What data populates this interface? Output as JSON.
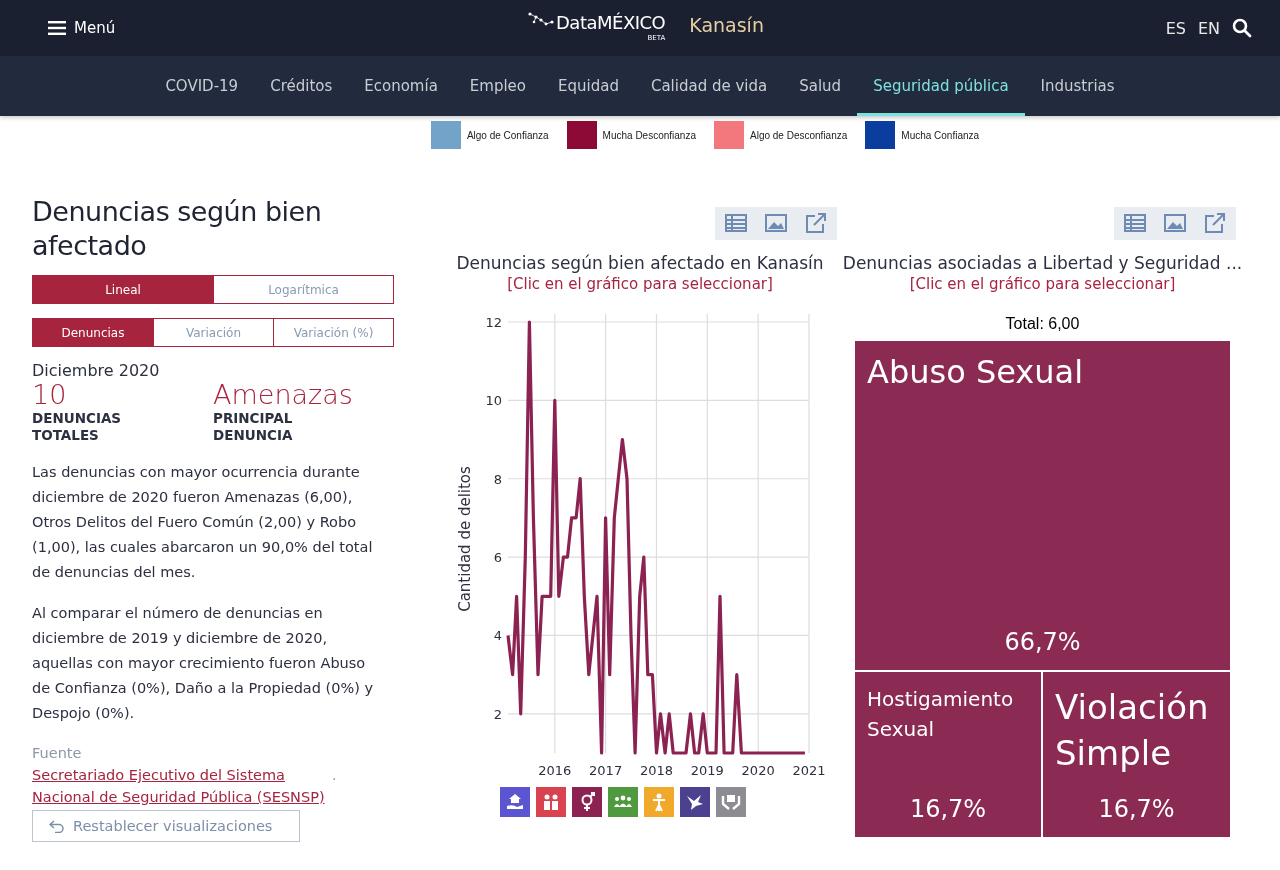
{
  "header": {
    "menu_label": "Menú",
    "logo": "DataMÉXICO",
    "logo_badge": "BETA",
    "place": "Kanasín",
    "languages": [
      {
        "label": "ES"
      },
      {
        "label": "EN"
      }
    ]
  },
  "nav": [
    {
      "label": "COVID-19",
      "selected": false
    },
    {
      "label": "Créditos",
      "selected": false
    },
    {
      "label": "Economía",
      "selected": false
    },
    {
      "label": "Empleo",
      "selected": false
    },
    {
      "label": "Equidad",
      "selected": false
    },
    {
      "label": "Calidad de vida",
      "selected": false
    },
    {
      "label": "Salud",
      "selected": false
    },
    {
      "label": "Seguridad pública",
      "selected": true
    },
    {
      "label": "Industrias",
      "selected": false
    }
  ],
  "legend": [
    {
      "label": "Algo de Confianza",
      "color": "#74a3c9"
    },
    {
      "label": "Mucha Desconfianza",
      "color": "#8c0a35"
    },
    {
      "label": "Algo de Desconfianza",
      "color": "#f2787d"
    },
    {
      "label": "Mucha Confianza",
      "color": "#0a3d9e"
    }
  ],
  "section": {
    "title": "Denuncias según bien afectado",
    "scale_toggle": [
      {
        "label": "Lineal",
        "selected": true
      },
      {
        "label": "Logarítmica",
        "selected": false
      }
    ],
    "measure_toggle": [
      {
        "label": "Denuncias",
        "selected": true
      },
      {
        "label": "Variación",
        "selected": false
      },
      {
        "label": "Variación (%)",
        "selected": false
      }
    ],
    "period": "Diciembre 2020",
    "stats": [
      {
        "value": "10",
        "label": "DENUNCIAS TOTALES"
      },
      {
        "value": "Amenazas",
        "label": "PRINCIPAL DENUNCIA"
      }
    ],
    "paragraphs": [
      "Las denuncias con mayor ocurrencia durante diciembre de 2020 fueron Amenazas (6,00), Otros Delitos del Fuero Común (2,00) y Robo (1,00), las cuales abarcaron un 90,0% del total de denuncias del mes.",
      "Al comparar el número de denuncias en diciembre de 2019 y diciembre de 2020, aquellas con mayor crecimiento fueron Abuso de Confianza (0%), Daño a la Propiedad (0%) y Despojo (0%)."
    ],
    "source_label": "Fuente",
    "source_link": "Secretariado Ejecutivo del Sistema Nacional de Seguridad Pública (SESNSP)",
    "source_end": ".",
    "reset_button": "Restablecer visualizaciones"
  },
  "line_panel": {
    "title": "Denuncias según bien afectado en Kanasín",
    "hint": "[Clic en el gráfico para seleccionar]",
    "chart_data": {
      "type": "line",
      "grid": true,
      "ylabel": "Cantidad de delitos",
      "xlim": [
        2015.08,
        2021
      ],
      "ylim": [
        1,
        12
      ],
      "xticks": [
        2016,
        2017,
        2018,
        2019,
        2020,
        2021
      ],
      "yticks": [
        2,
        4,
        6,
        8,
        10,
        12
      ],
      "x": [
        2015.08,
        2015.17,
        2015.25,
        2015.33,
        2015.42,
        2015.5,
        2015.58,
        2015.67,
        2015.75,
        2015.83,
        2015.92,
        2016,
        2016.08,
        2016.17,
        2016.25,
        2016.33,
        2016.42,
        2016.5,
        2016.58,
        2016.67,
        2016.75,
        2016.83,
        2016.92,
        2017,
        2017.08,
        2017.17,
        2017.25,
        2017.33,
        2017.42,
        2017.5,
        2017.58,
        2017.67,
        2017.75,
        2017.83,
        2017.92,
        2018,
        2018.08,
        2018.17,
        2018.25,
        2018.33,
        2018.42,
        2018.5,
        2018.58,
        2018.67,
        2018.75,
        2018.83,
        2018.92,
        2019,
        2019.08,
        2019.17,
        2019.25,
        2019.33,
        2019.42,
        2019.5,
        2019.58,
        2019.67,
        2019.75,
        2019.83,
        2019.92,
        2020,
        2020.08,
        2020.17,
        2020.25,
        2020.33,
        2020.42,
        2020.5,
        2020.58,
        2020.67,
        2020.75,
        2020.83,
        2020.92
      ],
      "series": [
        {
          "color": "#8b2252",
          "values": [
            4,
            3,
            5,
            2,
            6,
            12,
            7,
            3,
            5,
            5,
            5,
            10,
            5,
            6,
            6,
            7,
            7,
            8,
            5,
            3,
            4,
            5,
            1,
            7,
            3,
            7,
            8,
            9,
            8,
            4,
            1,
            5,
            6,
            3,
            3,
            1,
            2,
            1,
            2,
            1,
            1,
            1,
            1,
            2,
            1,
            1,
            2,
            1,
            1,
            1,
            5,
            1,
            1,
            1,
            3,
            1,
            1,
            1,
            1,
            1,
            1,
            1,
            1,
            1,
            1,
            1,
            1,
            1,
            1,
            1,
            1
          ]
        }
      ]
    },
    "topics": [
      {
        "color": "#5b55d1"
      },
      {
        "color": "#d8434f"
      },
      {
        "color": "#8b2252"
      },
      {
        "color": "#4f9a3f"
      },
      {
        "color": "#f0a92a"
      },
      {
        "color": "#4c418f"
      },
      {
        "color": "#8c8c92"
      }
    ]
  },
  "treemap_panel": {
    "title": "Denuncias asociadas a Libertad y Seguridad ...",
    "hint": "[Clic en el gráfico para seleccionar]",
    "total": "Total: 6,00",
    "tiles": [
      {
        "label": "Abuso Sexual",
        "share": "66,7%",
        "kind": "large"
      },
      {
        "label": "Hostigamiento Sexual",
        "share": "16,7%",
        "kind": "small"
      },
      {
        "label": "Violación Simple",
        "share": "16,7%",
        "kind": "medium"
      }
    ]
  }
}
